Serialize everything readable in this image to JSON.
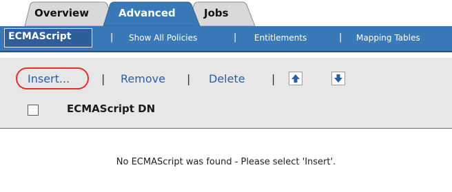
{
  "tabs": [
    {
      "label": "Overview",
      "active": false
    },
    {
      "label": "Advanced",
      "active": true
    },
    {
      "label": "Jobs",
      "active": false
    }
  ],
  "subnav": {
    "items": [
      {
        "label": "ECMAScript",
        "active": true
      },
      {
        "label": "Show All Policies"
      },
      {
        "label": "Entitlements"
      },
      {
        "label": "Mapping Tables"
      }
    ],
    "separator": "|"
  },
  "actions": {
    "insert": "Insert...",
    "remove": "Remove",
    "delete": "Delete",
    "separator": "|",
    "move_up_icon": "arrow-up-icon",
    "move_down_icon": "arrow-down-icon"
  },
  "table": {
    "column_header": "ECMAScript DN"
  },
  "message": "No ECMAScript was found - Please select 'Insert'.",
  "colors": {
    "subnav_bg": "#3a79b8",
    "active_tab": "#3a79b8",
    "link": "#2a5ea3",
    "highlight_ring": "#e0302a",
    "panel_bg": "#e7e7e7"
  }
}
